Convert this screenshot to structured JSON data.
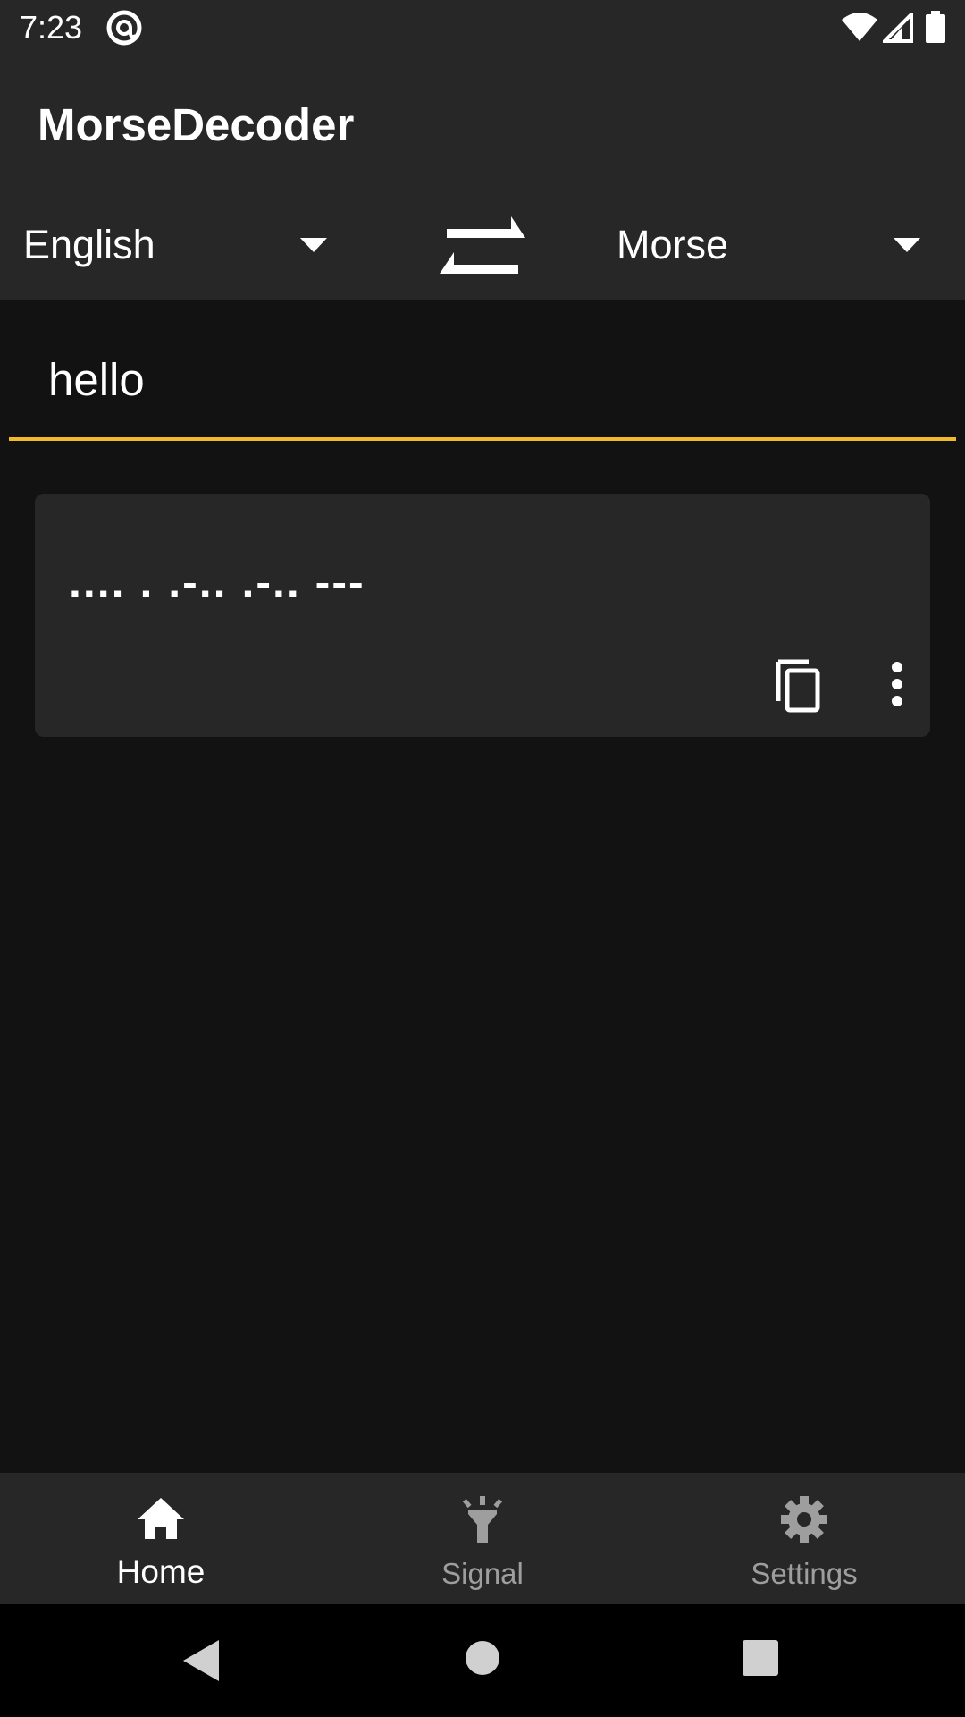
{
  "status_bar": {
    "time": "7:23"
  },
  "app_bar": {
    "title": "MorseDecoder"
  },
  "language_selector": {
    "source": "English",
    "target": "Morse"
  },
  "input": {
    "value": "hello",
    "underline_color": "#f2b92b"
  },
  "result": {
    "text": ".... . .-.. .-.. ---"
  },
  "bottom_nav": {
    "items": [
      {
        "label": "Home",
        "icon": "home-icon",
        "active": true
      },
      {
        "label": "Signal",
        "icon": "flashlight-icon",
        "active": false
      },
      {
        "label": "Settings",
        "icon": "gear-icon",
        "active": false
      }
    ]
  },
  "colors": {
    "surface": "#272727",
    "background": "#121212",
    "accent": "#f2b92b",
    "inactive": "#9e9e9e"
  }
}
